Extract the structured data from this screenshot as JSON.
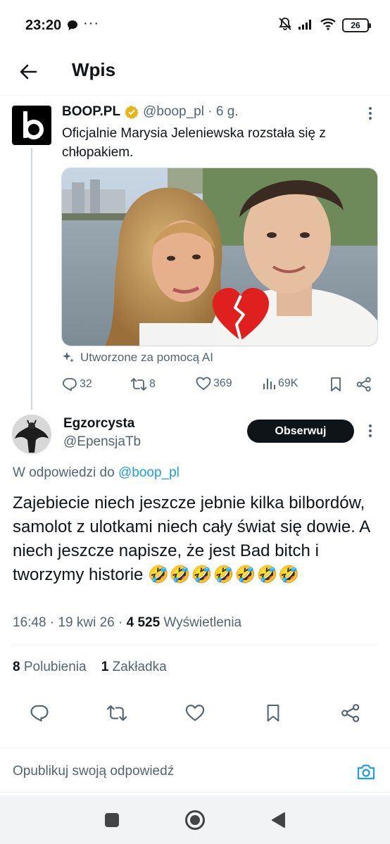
{
  "status_bar": {
    "time": "23:20",
    "dots": "···",
    "battery": "26"
  },
  "header": {
    "title": "Wpis"
  },
  "parent_tweet": {
    "author_name": "BOOP.PL",
    "handle_time": "@boop_pl · 6 g.",
    "text": "Oficjalnie Marysia Jeleniewska rozstała się z chłopakiem.",
    "ai_note": "Utworzone za pomocą AI",
    "stats": {
      "replies": "32",
      "retweets": "8",
      "likes": "369",
      "views": "69K"
    }
  },
  "reply_tweet": {
    "author_name": "Egzorcysta",
    "handle": "@EpensjaTb",
    "follow_label": "Obserwuj",
    "reply_to_prefix": "W odpowiedzi do ",
    "reply_to_mention": "@boop_pl",
    "text": "Zajebiecie niech jeszcze jebnie kilka bilbordów, samolot z ulotkami niech cały świat się dowie. A niech jeszcze napisze, że jest Bad bitch i tworzymy historie",
    "emojis": "🤣🤣🤣🤣🤣🤣🤣",
    "meta_prefix": "16:48 · 19 kwi 26 · ",
    "meta_views": "4 525",
    "meta_suffix": " Wyświetlenia",
    "likes_count": "8",
    "likes_label": " Polubienia",
    "bookmarks_count": "1",
    "bookmarks_label": " Zakładka"
  },
  "compose": {
    "placeholder": "Opublikuj swoją odpowiedź"
  },
  "colors": {
    "accent": "#1d9bf0",
    "text": "#0f1419",
    "secondary": "#536471",
    "verified": "#e2b719",
    "heart": "#e0201e"
  }
}
